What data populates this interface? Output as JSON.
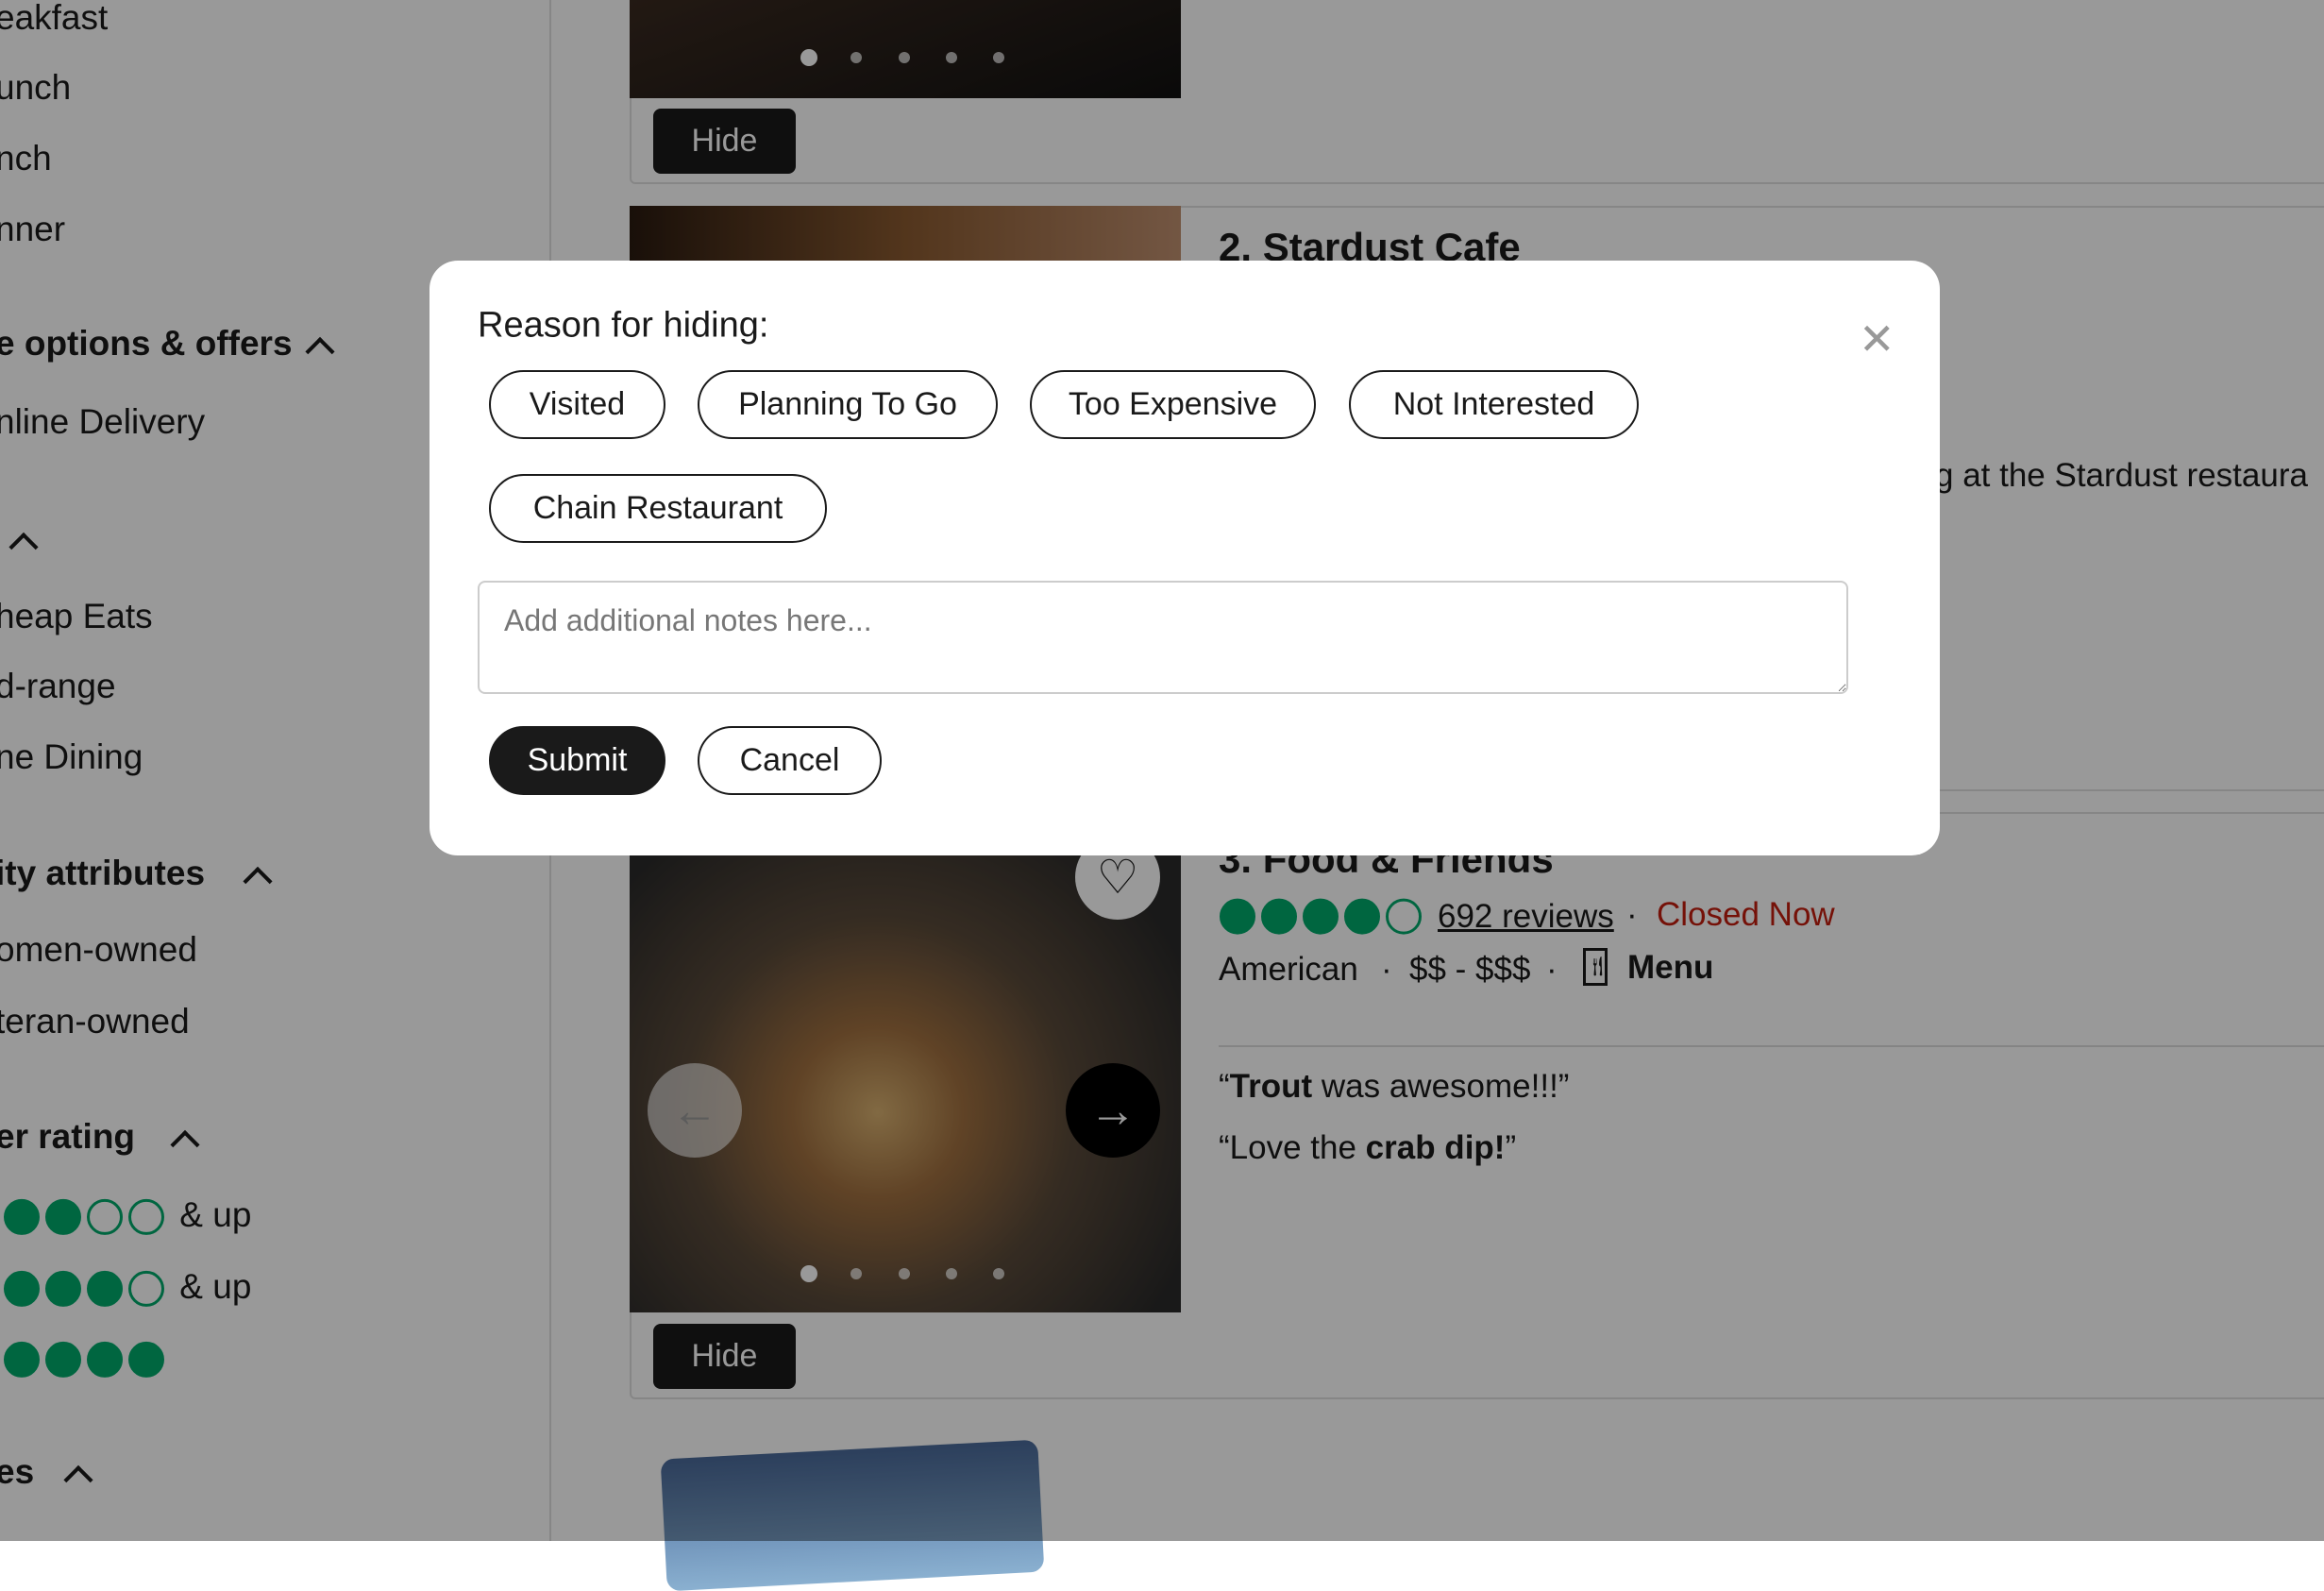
{
  "sidebar": {
    "meal_items": [
      "eakfast",
      "unch",
      "nch",
      "nner"
    ],
    "options_heading": "e options & offers",
    "options_items": [
      "nline Delivery"
    ],
    "price_items": [
      "heap Eats",
      "d-range",
      "ne Dining"
    ],
    "attributes_heading": "ity attributes",
    "attributes_items": [
      "omen-owned",
      "teran-owned"
    ],
    "rating_heading": "er rating",
    "rating_rows": [
      {
        "filled": 2,
        "label": "& up"
      },
      {
        "filled": 3,
        "label": "& up"
      },
      {
        "filled": 4,
        "label": ""
      }
    ],
    "last_heading": "es"
  },
  "listings": [
    {
      "hide_label": "Hide"
    },
    {
      "title": "2. Stardust Cafe",
      "snippet": "g at the Stardust restaura"
    },
    {
      "title": "3. Food & Friends",
      "rating": 4,
      "reviews": "692 reviews",
      "status": "Closed Now",
      "cuisine": "American",
      "price": "$$ - $$$",
      "menu_label": "Menu",
      "quotes": [
        {
          "pre": "“",
          "bold": "Trout",
          "post": " was awesome!!!”"
        },
        {
          "pre": "“Love the ",
          "bold": "crab dip!",
          "post": "”"
        }
      ],
      "hide_label": "Hide"
    }
  ],
  "modal": {
    "title": "Reason for hiding:",
    "reasons": [
      "Visited",
      "Planning To Go",
      "Too Expensive",
      "Not Interested",
      "Chain Restaurant"
    ],
    "notes_placeholder": "Add additional notes here...",
    "submit_label": "Submit",
    "cancel_label": "Cancel"
  },
  "colors": {
    "rating_green": "#00aa6c",
    "closed_red": "#c41d0e",
    "overlay": "rgba(0,0,0,0.4)"
  }
}
